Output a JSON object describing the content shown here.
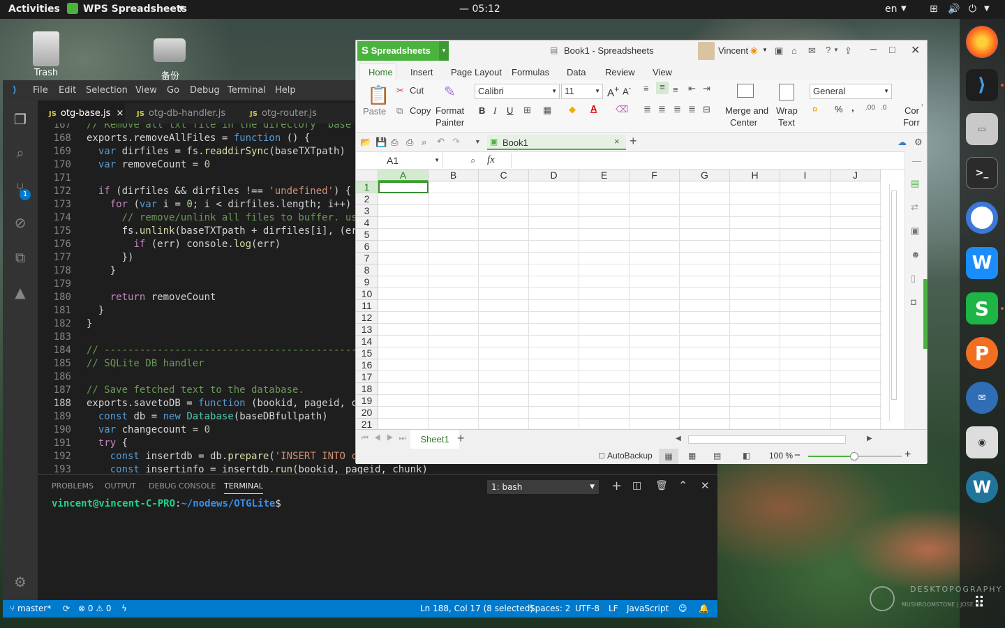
{
  "topbar": {
    "activities": "Activities",
    "app_menu": "WPS Spreadsheets",
    "clock": "— 05:12",
    "lang": "en"
  },
  "desktop": {
    "trash": "Trash",
    "drive": "备份"
  },
  "vscode": {
    "menu": [
      "File",
      "Edit",
      "Selection",
      "View",
      "Go",
      "Debug",
      "Terminal",
      "Help"
    ],
    "tabs": [
      {
        "label": "otg-base.js"
      },
      {
        "label": "otg-db-handler.js"
      },
      {
        "label": "otg-router.js"
      }
    ],
    "line_numbers": [
      "167",
      "168",
      "169",
      "170",
      "171",
      "172",
      "173",
      "174",
      "175",
      "176",
      "177",
      "178",
      "179",
      "180",
      "181",
      "182",
      "183",
      "184",
      "185",
      "186",
      "187",
      "188",
      "189",
      "190",
      "191",
      "192",
      "193"
    ],
    "code": [
      "// Remove all txt file in the directory  base",
      "exports.removeAllFiles = function () {",
      "  var dirfiles = fs.readdirSync(baseTXTpath)",
      "  var removeCount = 0",
      "",
      "  if (dirfiles && dirfiles !== 'undefined') {",
      "    for (var i = 0; i < dirfiles.length; i++)",
      "      // remove/unlink all files to buffer. us",
      "      fs.unlink(baseTXTpath + dirfiles[i], (er",
      "        if (err) console.log(err)",
      "      })",
      "    }",
      "",
      "    return removeCount",
      "  }",
      "}",
      "",
      "// --------------------------------------------",
      "// SQLite DB handler",
      "",
      "// Save fetched text to the database.",
      "exports.savetoDB = function (bookid, pageid, c",
      "  const db = new Database(baseDBfullpath)",
      "  var changecount = 0",
      "  try {",
      "    const insertdb = db.prepare('INSERT INTO c",
      "    const insertinfo = insertdb.run(bookid, pageid, chunk)"
    ],
    "panel_tabs": [
      "PROBLEMS",
      "OUTPUT",
      "DEBUG CONSOLE",
      "TERMINAL"
    ],
    "terminal_select": "1: bash",
    "prompt_user": "vincent@vincent-C-PRO",
    "prompt_path": "~/nodews/OTGLite",
    "prompt_symbol": "$",
    "status": {
      "branch": "master*",
      "errors": "0",
      "warnings": "0",
      "position": "Ln 188, Col 17 (8 selected)",
      "spaces": "Spaces: 2",
      "encoding": "UTF-8",
      "eol": "LF",
      "language": "JavaScript"
    },
    "scm_badge": "1"
  },
  "wps": {
    "app_button": "Spreadsheets",
    "title": "Book1 - Spreadsheets",
    "user": "Vincent",
    "help": "?",
    "tabs": [
      "Home",
      "Insert",
      "Page Layout",
      "Formulas",
      "Data",
      "Review",
      "View"
    ],
    "ribbon": {
      "paste": "Paste",
      "cut": "Cut",
      "copy": "Copy",
      "format_painter_1": "Format",
      "format_painter_2": "Painter",
      "font": "Calibri",
      "size": "11",
      "merge_1": "Merge and",
      "merge_2": "Center",
      "wrap_1": "Wrap",
      "wrap_2": "Text",
      "number_format": "General",
      "cond_1": "Cor",
      "cond_2": "Forr",
      "bold": "B",
      "italic": "I",
      "underline": "U",
      "percent": "%",
      "comma": ","
    },
    "doc_tab": "Book1",
    "name_box": "A1",
    "fx": "fx",
    "columns": [
      "A",
      "B",
      "C",
      "D",
      "E",
      "F",
      "G",
      "H",
      "I",
      "J"
    ],
    "rows": [
      "1",
      "2",
      "3",
      "4",
      "5",
      "6",
      "7",
      "8",
      "9",
      "10",
      "11",
      "12",
      "13",
      "14",
      "15",
      "16",
      "17",
      "18",
      "19",
      "20",
      "21"
    ],
    "sheet": "Sheet1",
    "autobackup": "AutoBackup",
    "zoom": "100 %"
  },
  "watermark": {
    "brand": "DESKTOPOGRAPHY",
    "credit": "MUSHROOMSTONE | JOSE NA"
  },
  "colors": {
    "wps_green": "#4ab33e",
    "vscode_blue": "#007acc",
    "topbar": "#1c1c1c"
  }
}
